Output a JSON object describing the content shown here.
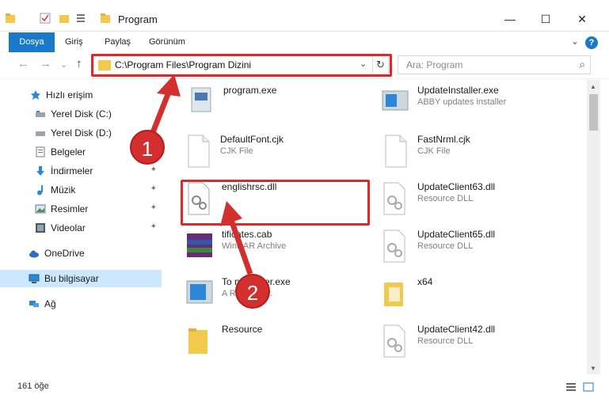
{
  "window": {
    "title": "Program",
    "controls": {
      "minimize": "—",
      "maximize": "☐",
      "close": "✕"
    }
  },
  "ribbon": {
    "tabs": [
      {
        "label": "Dosya"
      },
      {
        "label": "Giriş"
      },
      {
        "label": "Paylaş"
      },
      {
        "label": "Görünüm"
      }
    ],
    "help_label": "?",
    "accent": "#1979ca"
  },
  "navigation": {
    "back": "←",
    "forward": "→",
    "recent": "⌄",
    "up": "↑",
    "address": "C:\\Program Files\\Program Dizini",
    "address_dropdown": "⌄",
    "refresh": "↻",
    "search_placeholder": "Ara: Program",
    "search_icon": "⌕"
  },
  "sidebar": {
    "items": [
      {
        "label": "Hızlı erişim",
        "icon": "star-icon",
        "pinned": false
      },
      {
        "label": "Yerel Disk (C:)",
        "icon": "drive-icon",
        "pinned": false
      },
      {
        "label": "Yerel Disk (D:)",
        "icon": "drive-icon",
        "pinned": false
      },
      {
        "label": "Belgeler",
        "icon": "documents-icon",
        "pinned": false
      },
      {
        "label": "İndirmeler",
        "icon": "download-icon",
        "pinned": true
      },
      {
        "label": "Müzik",
        "icon": "music-icon",
        "pinned": true
      },
      {
        "label": "Resimler",
        "icon": "pictures-icon",
        "pinned": true
      },
      {
        "label": "Videolar",
        "icon": "videos-icon",
        "pinned": true
      },
      {
        "label": "OneDrive",
        "icon": "cloud-icon",
        "pinned": false
      },
      {
        "label": "Bu bilgisayar",
        "icon": "computer-icon",
        "pinned": false,
        "selected": true
      },
      {
        "label": "Ağ",
        "icon": "network-icon",
        "pinned": false
      }
    ],
    "pin_glyph": "📌"
  },
  "files": [
    {
      "name": "program.exe",
      "type": ""
    },
    {
      "name": "UpdateInstaller.exe",
      "type": "ABBY updates installer"
    },
    {
      "name": "DefaultFont.cjk",
      "type": "CJK File"
    },
    {
      "name": "FastNrml.cjk",
      "type": "CJK File"
    },
    {
      "name": "englishrsc.dll",
      "type": ""
    },
    {
      "name": "UpdateClient63.dll",
      "type": "Resource DLL"
    },
    {
      "name": "tificates.cab",
      "type": "WinRAR Archive"
    },
    {
      "name": "UpdateClient65.dll",
      "type": "Resource DLL"
    },
    {
      "name": "To        nInstaller.exe",
      "type": "A       Reader tr..."
    },
    {
      "name": "x64",
      "type": ""
    },
    {
      "name": "Resource",
      "type": ""
    },
    {
      "name": "UpdateClient42.dll",
      "type": "Resource DLL"
    }
  ],
  "status": {
    "item_count": "161 öğe"
  },
  "annotations": {
    "step1": "1",
    "step2": "2",
    "color": "#d92b2b"
  }
}
